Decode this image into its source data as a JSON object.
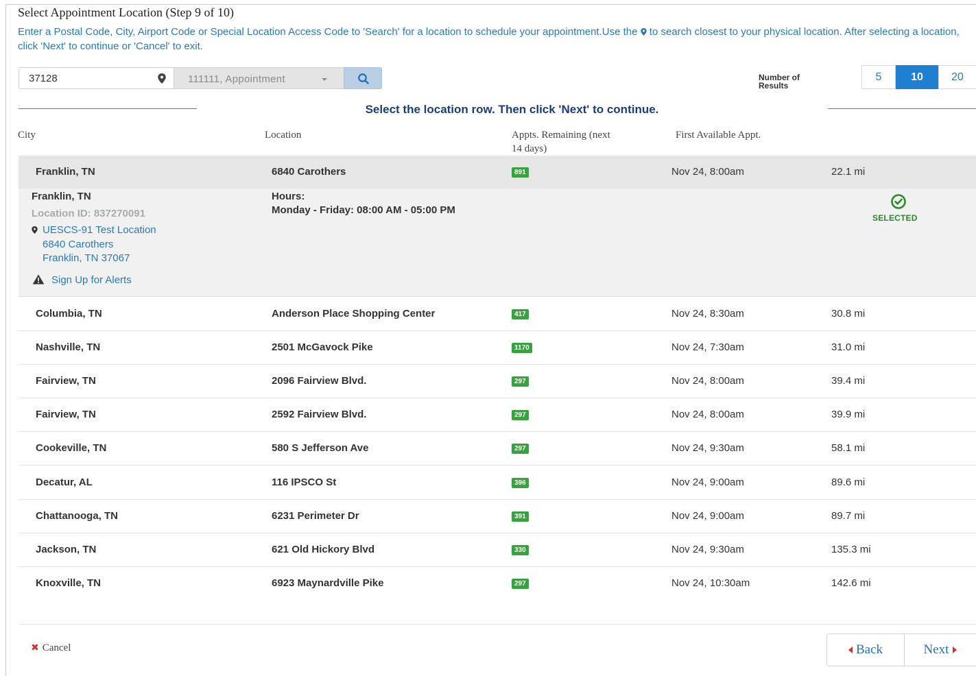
{
  "header": {
    "title": "Select Appointment Location (Step 9 of 10)",
    "instructions_1": "Enter a Postal Code, City, Airport Code or Special Location Access Code to 'Search' for a location to schedule your appointment.Use the",
    "instructions_2": "to search closest to your physical location. After selecting a location, click 'Next' to continue or 'Cancel' to exit."
  },
  "search": {
    "zip_value": "37128",
    "code_select_value": "111111, Appointment"
  },
  "results_count": {
    "label_1": "Number of",
    "label_2": "Results",
    "options": [
      "5",
      "10",
      "20"
    ],
    "selected": "10"
  },
  "prompt": "Select the location row. Then click 'Next' to continue.",
  "columns": {
    "city": "City",
    "location": "Location",
    "remaining_1": "Appts. Remaining (next",
    "remaining_2": "14 days)",
    "first_available": "First Available Appt."
  },
  "rows": [
    {
      "city": "Franklin, TN",
      "location": "6840 Carothers",
      "remaining": "891",
      "first": "Nov 24, 8:00am",
      "distance": "22.1 mi"
    },
    {
      "city": "Columbia, TN",
      "location": "Anderson Place Shopping Center",
      "remaining": "417",
      "first": "Nov 24, 8:30am",
      "distance": "30.8 mi"
    },
    {
      "city": "Nashville, TN",
      "location": "2501 McGavock Pike",
      "remaining": "1170",
      "first": "Nov 24, 7:30am",
      "distance": "31.0 mi"
    },
    {
      "city": "Fairview, TN",
      "location": "2096 Fairview Blvd.",
      "remaining": "297",
      "first": "Nov 24, 8:00am",
      "distance": "39.4 mi"
    },
    {
      "city": "Fairview, TN",
      "location": "2592 Fairview Blvd.",
      "remaining": "297",
      "first": "Nov 24, 8:00am",
      "distance": "39.9 mi"
    },
    {
      "city": "Cookeville, TN",
      "location": "580 S Jefferson Ave",
      "remaining": "297",
      "first": "Nov 24, 9:30am",
      "distance": "58.1 mi"
    },
    {
      "city": "Decatur, AL",
      "location": "116 IPSCO St",
      "remaining": "396",
      "first": "Nov 24, 9:00am",
      "distance": "89.6 mi"
    },
    {
      "city": "Chattanooga, TN",
      "location": "6231 Perimeter Dr",
      "remaining": "391",
      "first": "Nov 24, 9:00am",
      "distance": "89.7 mi"
    },
    {
      "city": "Jackson, TN",
      "location": "621 Old Hickory Blvd",
      "remaining": "330",
      "first": "Nov 24, 9:30am",
      "distance": "135.3 mi"
    },
    {
      "city": "Knoxville, TN",
      "location": "6923 Maynardville Pike",
      "remaining": "297",
      "first": "Nov 24, 10:30am",
      "distance": "142.6 mi"
    }
  ],
  "selected_detail": {
    "city": "Franklin, TN",
    "location_id": "Location ID: 837270091",
    "site_name": "UESCS-91 Test Location",
    "street": "6840 Carothers",
    "city_zip": "Franklin, TN 37067",
    "alerts_link": "Sign Up for Alerts",
    "hours_label": "Hours:",
    "hours_value": "Monday - Friday: 08:00 AM - 05:00 PM",
    "status": "SELECTED"
  },
  "footer": {
    "cancel": "Cancel",
    "back": "Back",
    "next": "Next"
  },
  "colors": {
    "link_blue": "#2a7ab8",
    "active_blue": "#1f7fd1",
    "badge_green": "#3aa140",
    "prompt_navy": "#1d3d7a",
    "cancel_red": "#d0342c"
  },
  "icons": {
    "pin": "map-pin-icon",
    "search": "search-icon",
    "selected": "check-circle-icon",
    "alert": "warning-icon",
    "cancel": "close-icon"
  }
}
